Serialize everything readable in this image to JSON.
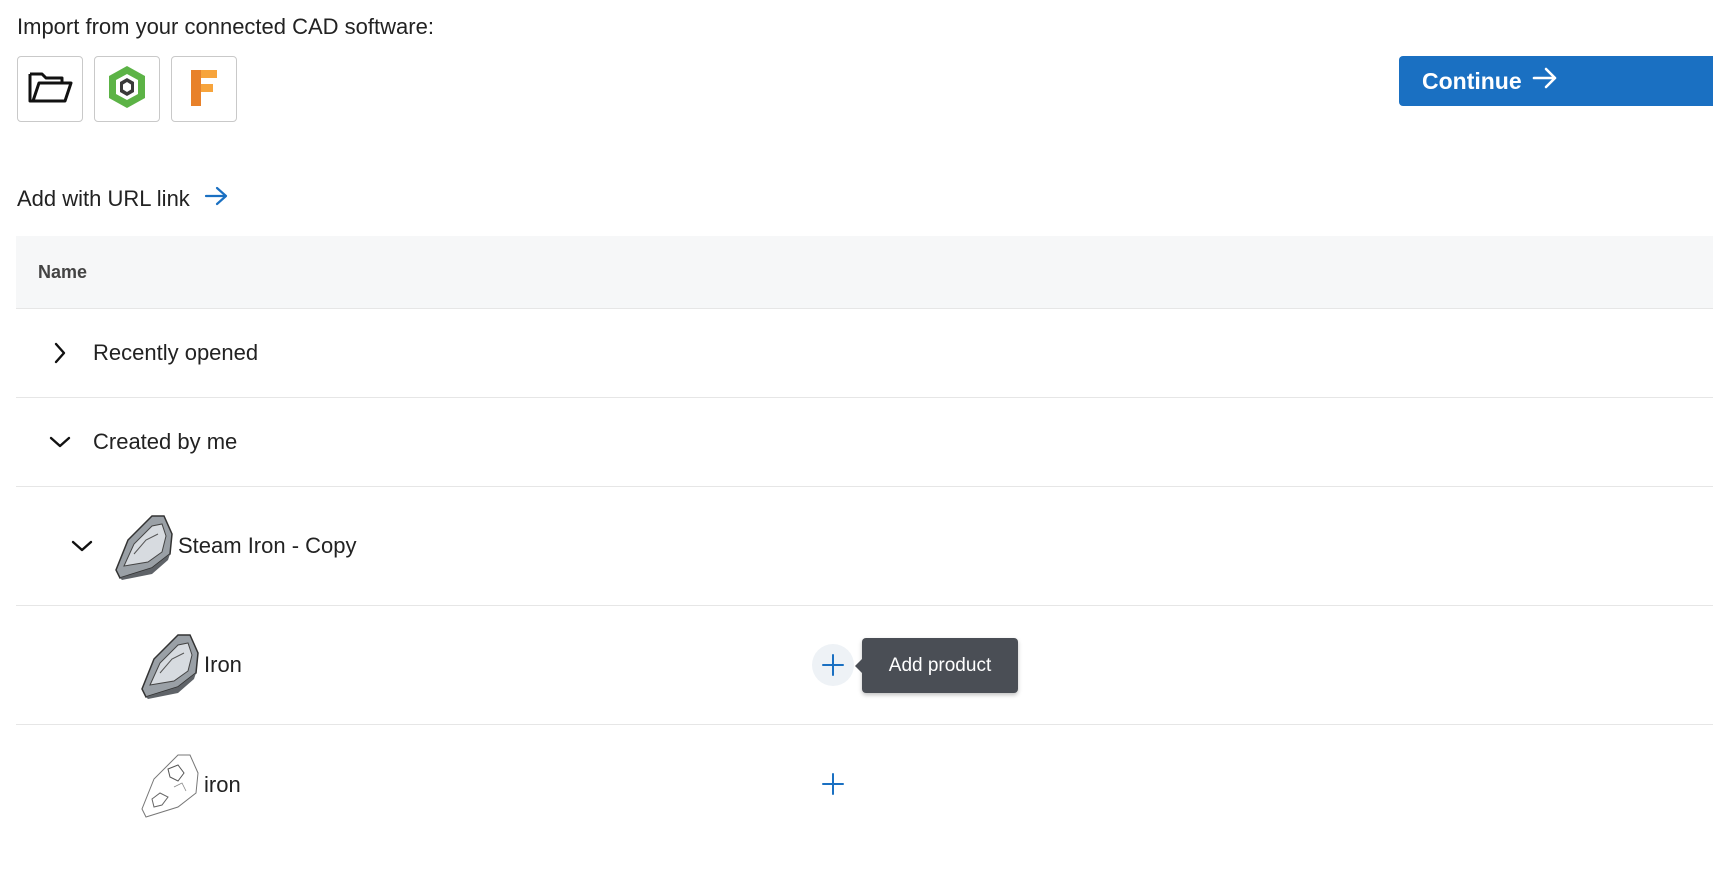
{
  "import": {
    "label": "Import from your connected CAD software:",
    "sources": [
      {
        "name": "folder-icon"
      },
      {
        "name": "onshape-logo-icon"
      },
      {
        "name": "fusion-logo-icon"
      }
    ]
  },
  "continue_label": "Continue",
  "url_link_label": "Add with URL link",
  "table": {
    "header_name": "Name",
    "groups": {
      "recent": "Recently opened",
      "created": "Created by me"
    },
    "items": {
      "steam_iron_copy": "Steam Iron - Copy",
      "iron_1": "Iron",
      "iron_2": "iron"
    }
  },
  "tooltip": "Add product",
  "colors": {
    "accent": "#1a70c2",
    "tooltip_bg": "#4a4e55"
  }
}
